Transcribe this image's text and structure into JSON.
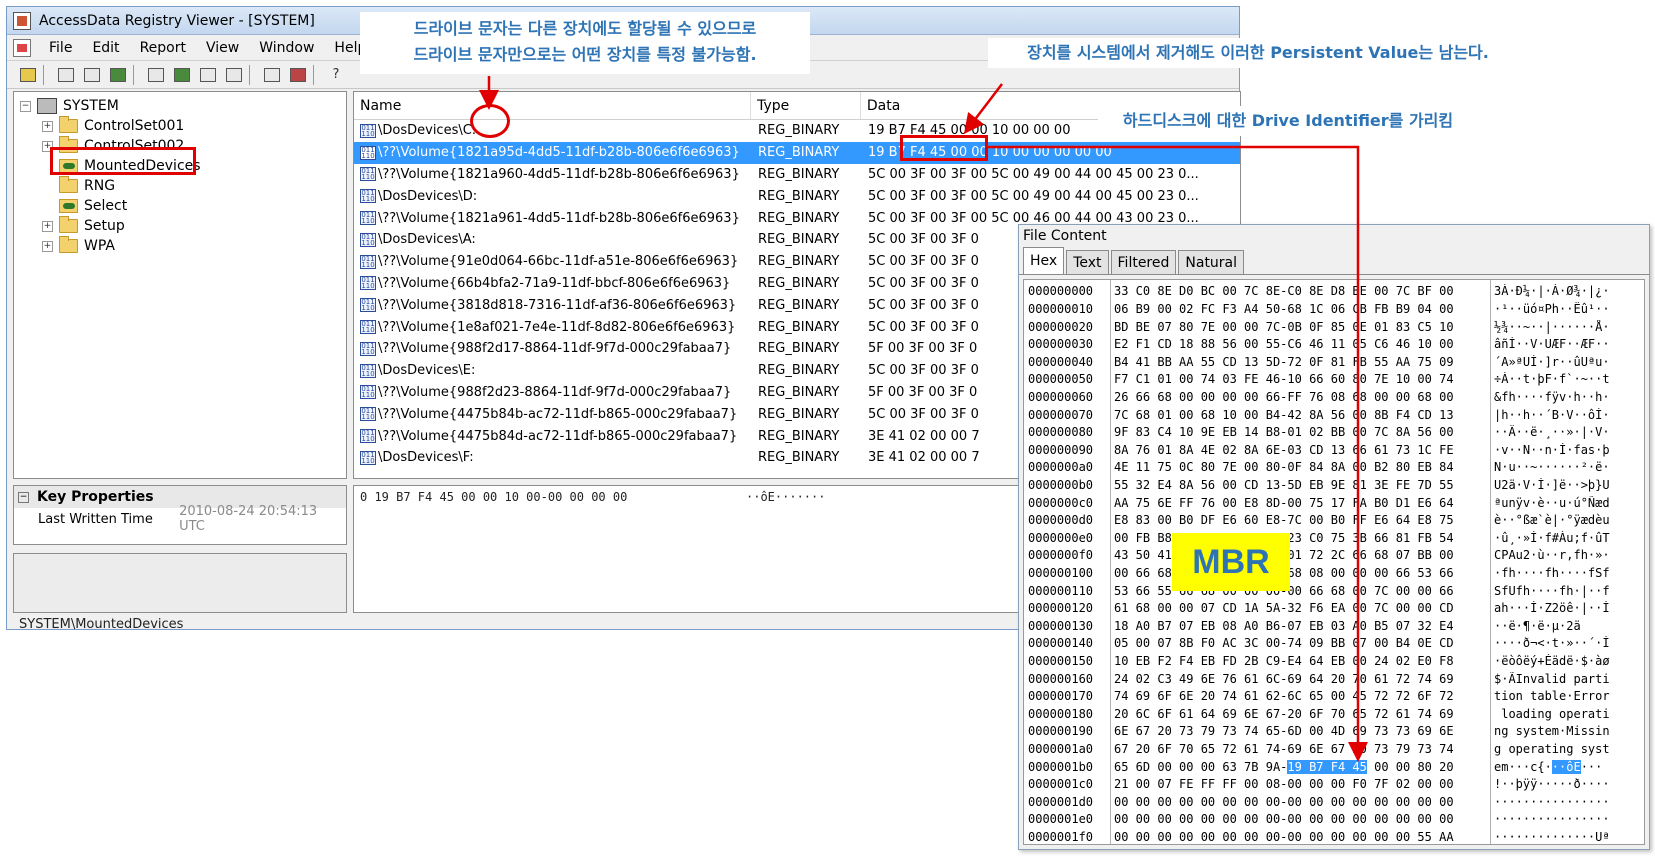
{
  "window": {
    "title": "AccessData Registry Viewer - [SYSTEM]",
    "menu": [
      "File",
      "Edit",
      "Report",
      "View",
      "Window",
      "Help"
    ]
  },
  "tree": {
    "root": "SYSTEM",
    "items": [
      {
        "label": "ControlSet001",
        "expandable": true
      },
      {
        "label": "ControlSet002",
        "expandable": true
      },
      {
        "label": "MountedDevices",
        "expandable": false
      },
      {
        "label": "RNG",
        "expandable": false
      },
      {
        "label": "Select",
        "expandable": false
      },
      {
        "label": "Setup",
        "expandable": true
      },
      {
        "label": "WPA",
        "expandable": true
      }
    ]
  },
  "key_properties": {
    "header": "Key Properties",
    "rows": [
      {
        "key": "Last Written Time",
        "value": "2010-08-24 20:54:13 UTC"
      }
    ]
  },
  "values_list": {
    "columns": [
      "Name",
      "Type",
      "Data"
    ],
    "rows": [
      {
        "name": "\\DosDevices\\C:",
        "type": "REG_BINARY",
        "data": "19 B7 F4 45 00 00 10 00 00 00"
      },
      {
        "name": "\\??\\Volume{1821a95d-4dd5-11df-b28b-806e6f6e6963}",
        "type": "REG_BINARY",
        "data": "19 B7 F4 45 00 00 10 00 00 00 00 00",
        "selected": true
      },
      {
        "name": "\\??\\Volume{1821a960-4dd5-11df-b28b-806e6f6e6963}",
        "type": "REG_BINARY",
        "data": "5C 00 3F 00 3F 00 5C 00 49 00 44 00 45 00 23 0..."
      },
      {
        "name": "\\DosDevices\\D:",
        "type": "REG_BINARY",
        "data": "5C 00 3F 00 3F 00 5C 00 49 00 44 00 45 00 23 0..."
      },
      {
        "name": "\\??\\Volume{1821a961-4dd5-11df-b28b-806e6f6e6963}",
        "type": "REG_BINARY",
        "data": "5C 00 3F 00 3F 00 5C 00 46 00 44 00 43 00 23 0..."
      },
      {
        "name": "\\DosDevices\\A:",
        "type": "REG_BINARY",
        "data": "5C 00 3F 00 3F 0"
      },
      {
        "name": "\\??\\Volume{91e0d064-66bc-11df-a51e-806e6f6e6963}",
        "type": "REG_BINARY",
        "data": "5C 00 3F 00 3F 0"
      },
      {
        "name": "\\??\\Volume{66b4bfa2-71a9-11df-bbcf-806e6f6e6963}",
        "type": "REG_BINARY",
        "data": "5C 00 3F 00 3F 0"
      },
      {
        "name": "\\??\\Volume{3818d818-7316-11df-af36-806e6f6e6963}",
        "type": "REG_BINARY",
        "data": "5C 00 3F 00 3F 0"
      },
      {
        "name": "\\??\\Volume{1e8af021-7e4e-11df-8d82-806e6f6e6963}",
        "type": "REG_BINARY",
        "data": "5C 00 3F 00 3F 0"
      },
      {
        "name": "\\??\\Volume{988f2d17-8864-11df-9f7d-000c29fabaa7}",
        "type": "REG_BINARY",
        "data": "5F 00 3F 00 3F 0"
      },
      {
        "name": "\\DosDevices\\E:",
        "type": "REG_BINARY",
        "data": "5C 00 3F 00 3F 0"
      },
      {
        "name": "\\??\\Volume{988f2d23-8864-11df-9f7d-000c29fabaa7}",
        "type": "REG_BINARY",
        "data": "5F 00 3F 00 3F 0"
      },
      {
        "name": "\\??\\Volume{4475b84b-ac72-11df-b865-000c29fabaa7}",
        "type": "REG_BINARY",
        "data": "5C 00 3F 00 3F 0"
      },
      {
        "name": "\\??\\Volume{4475b84d-ac72-11df-b865-000c29fabaa7}",
        "type": "REG_BINARY",
        "data": "3E 41 02 00 00 7"
      },
      {
        "name": "\\DosDevices\\F:",
        "type": "REG_BINARY",
        "data": "3E 41 02 00 00 7"
      }
    ]
  },
  "hex_pane": {
    "line": "0 19 B7 F4 45 00 00 10 00-00 00 00 00",
    "ascii": "··ôE·······"
  },
  "status_bar": "SYSTEM\\MountedDevices",
  "file_content": {
    "title": "File Content",
    "tabs": [
      "Hex",
      "Text",
      "Filtered",
      "Natural"
    ],
    "active_tab": "Hex",
    "rows": [
      {
        "off": "000000000",
        "bytes": "33 C0 8E D0 BC 00 7C 8E-C0 8E D8 BE 00 7C BF 00",
        "ascii": "3À·Ð¼·|·À·Ø¾·|¿·"
      },
      {
        "off": "000000010",
        "bytes": "06 B9 00 02 FC F3 A4 50-68 1C 06 CB FB B9 04 00",
        "ascii": "·¹··üó¤Ph··Ëû¹··"
      },
      {
        "off": "000000020",
        "bytes": "BD BE 07 80 7E 00 00 7C-0B 0F 85 0E 01 83 C5 10",
        "ascii": "½¾··~··|······Å·"
      },
      {
        "off": "000000030",
        "bytes": "E2 F1 CD 18 88 56 00 55-C6 46 11 05 C6 46 10 00",
        "ascii": "âñÍ··V·UÆF··ÆF··"
      },
      {
        "off": "000000040",
        "bytes": "B4 41 BB AA 55 CD 13 5D-72 0F 81 FB 55 AA 75 09",
        "ascii": "´A»ªUÍ·]r··ûUªu·"
      },
      {
        "off": "000000050",
        "bytes": "F7 C1 01 00 74 03 FE 46-10 66 60 80 7E 10 00 74",
        "ascii": "÷Á··t·þF·f`·~··t"
      },
      {
        "off": "000000060",
        "bytes": "26 66 68 00 00 00 00 66-FF 76 08 68 00 00 68 00",
        "ascii": "&fh····fÿv·h··h·"
      },
      {
        "off": "000000070",
        "bytes": "7C 68 01 00 68 10 00 B4-42 8A 56 00 8B F4 CD 13",
        "ascii": "|h··h··´B·V··ôÍ·"
      },
      {
        "off": "000000080",
        "bytes": "9F 83 C4 10 9E EB 14 B8-01 02 BB 00 7C 8A 56 00",
        "ascii": "··Ä··ë·¸··»·|·V·"
      },
      {
        "off": "000000090",
        "bytes": "8A 76 01 8A 4E 02 8A 6E-03 CD 13 66 61 73 1C FE",
        "ascii": "·v··N··n·Í·fas·þ"
      },
      {
        "off": "0000000a0",
        "bytes": "4E 11 75 0C 80 7E 00 80-0F 84 8A 00 B2 80 EB 84",
        "ascii": "N·u··~······²·ë·"
      },
      {
        "off": "0000000b0",
        "bytes": "55 32 E4 8A 56 00 CD 13-5D EB 9E 81 3E FE 7D 55",
        "ascii": "U2ä·V·Í·]ë··>þ}U"
      },
      {
        "off": "0000000c0",
        "bytes": "AA 75 6E FF 76 00 E8 8D-00 75 17 FA B0 D1 E6 64",
        "ascii": "ªunÿv·è··u·ú°Ñæd"
      },
      {
        "off": "0000000d0",
        "bytes": "E8 83 00 B0 DF E6 60 E8-7C 00 B0 FF E6 64 E8 75",
        "ascii": "è··°ßæ`è|·°ÿædèu"
      },
      {
        "off": "0000000e0",
        "bytes": "00 FB B8 00 BB CD 1A 66-23 C0 75 3B 66 81 FB 54",
        "ascii": "·û¸·»Í·f#Àu;f·ûT"
      },
      {
        "off": "0000000f0",
        "bytes": "43 50 41 75 32 81 F9 02-01 72 2C 66 68 07 BB 00",
        "ascii": "CPAu2·ù··r,fh·»·"
      },
      {
        "off": "000000100",
        "bytes": "00 66 68 00 02 00 00 66-68 08 00 00 00 66 53 66",
        "ascii": "·fh····fh····fSf"
      },
      {
        "off": "000000110",
        "bytes": "53 66 55 66 68 00 00 00-00 66 68 00 7C 00 00 66",
        "ascii": "SfUfh····fh·|··f"
      },
      {
        "off": "000000120",
        "bytes": "61 68 00 00 07 CD 1A 5A-32 F6 EA 00 7C 00 00 CD",
        "ascii": "ah···Í·Z2öê·|··Í"
      },
      {
        "off": "000000130",
        "bytes": "18 A0 B7 07 EB 08 A0 B6-07 EB 03 A0 B5 07 32 E4",
        "ascii": "··ë·¶·ë·µ·2ä"
      },
      {
        "off": "000000140",
        "bytes": "05 00 07 8B F0 AC 3C 00-74 09 BB 07 00 B4 0E CD",
        "ascii": "····ð¬<·t·»··´·Í"
      },
      {
        "off": "000000150",
        "bytes": "10 EB F2 F4 EB FD 2B C9-E4 64 EB 00 24 02 E0 F8",
        "ascii": "·ëòôëý+Éädë·$·àø"
      },
      {
        "off": "000000160",
        "bytes": "24 02 C3 49 6E 76 61 6C-69 64 20 70 61 72 74 69",
        "ascii": "$·ÃInvalid parti"
      },
      {
        "off": "000000170",
        "bytes": "74 69 6F 6E 20 74 61 62-6C 65 00 45 72 72 6F 72",
        "ascii": "tion table·Error"
      },
      {
        "off": "000000180",
        "bytes": "20 6C 6F 61 64 69 6E 67-20 6F 70 65 72 61 74 69",
        "ascii": " loading operati"
      },
      {
        "off": "000000190",
        "bytes": "6E 67 20 73 79 73 74 65-6D 00 4D 69 73 73 69 6E",
        "ascii": "ng system·Missin"
      },
      {
        "off": "0000001a0",
        "bytes": "67 20 6F 70 65 72 61 74-69 6E 67 20 73 79 73 74",
        "ascii": "g operating syst"
      },
      {
        "off": "0000001b0",
        "bytes_pre": "65 6D 00 00 00 63 7B 9A-",
        "bytes_hl": "19 B7 F4 45",
        "bytes_post": " 00 00 80 20",
        "ascii_pre": "em···c{·",
        "ascii_hl": "··ôE",
        "ascii_post": "··· "
      },
      {
        "off": "0000001c0",
        "bytes": "21 00 07 FE FF FF 00 08-00 00 00 F0 7F 02 00 00",
        "ascii": "!··þÿÿ·····ð····"
      },
      {
        "off": "0000001d0",
        "bytes": "00 00 00 00 00 00 00 00-00 00 00 00 00 00 00 00",
        "ascii": "················"
      },
      {
        "off": "0000001e0",
        "bytes": "00 00 00 00 00 00 00 00-00 00 00 00 00 00 00 00",
        "ascii": "················"
      },
      {
        "off": "0000001f0",
        "bytes": "00 00 00 00 00 00 00 00-00 00 00 00 00 00 55 AA",
        "ascii": "··············Uª"
      }
    ]
  },
  "annotations": {
    "note1_line1": "드라이브 문자는 다른 장치에도 할당될 수 있으므로",
    "note1_line2": "드라이브 문자만으로는 어떤 장치를 특정 불가능함.",
    "note2": "장치를 시스템에서 제거해도 이러한 Persistent Value는 남는다.",
    "note3": "하드디스크에 대한 Drive Identifier를 가리킴",
    "mbr": "MBR"
  },
  "colors": {
    "selection": "#3399ff",
    "annotation_text": "#2e74b5",
    "annotation_red": "#e00000",
    "mbr_bg": "#ffff00"
  }
}
